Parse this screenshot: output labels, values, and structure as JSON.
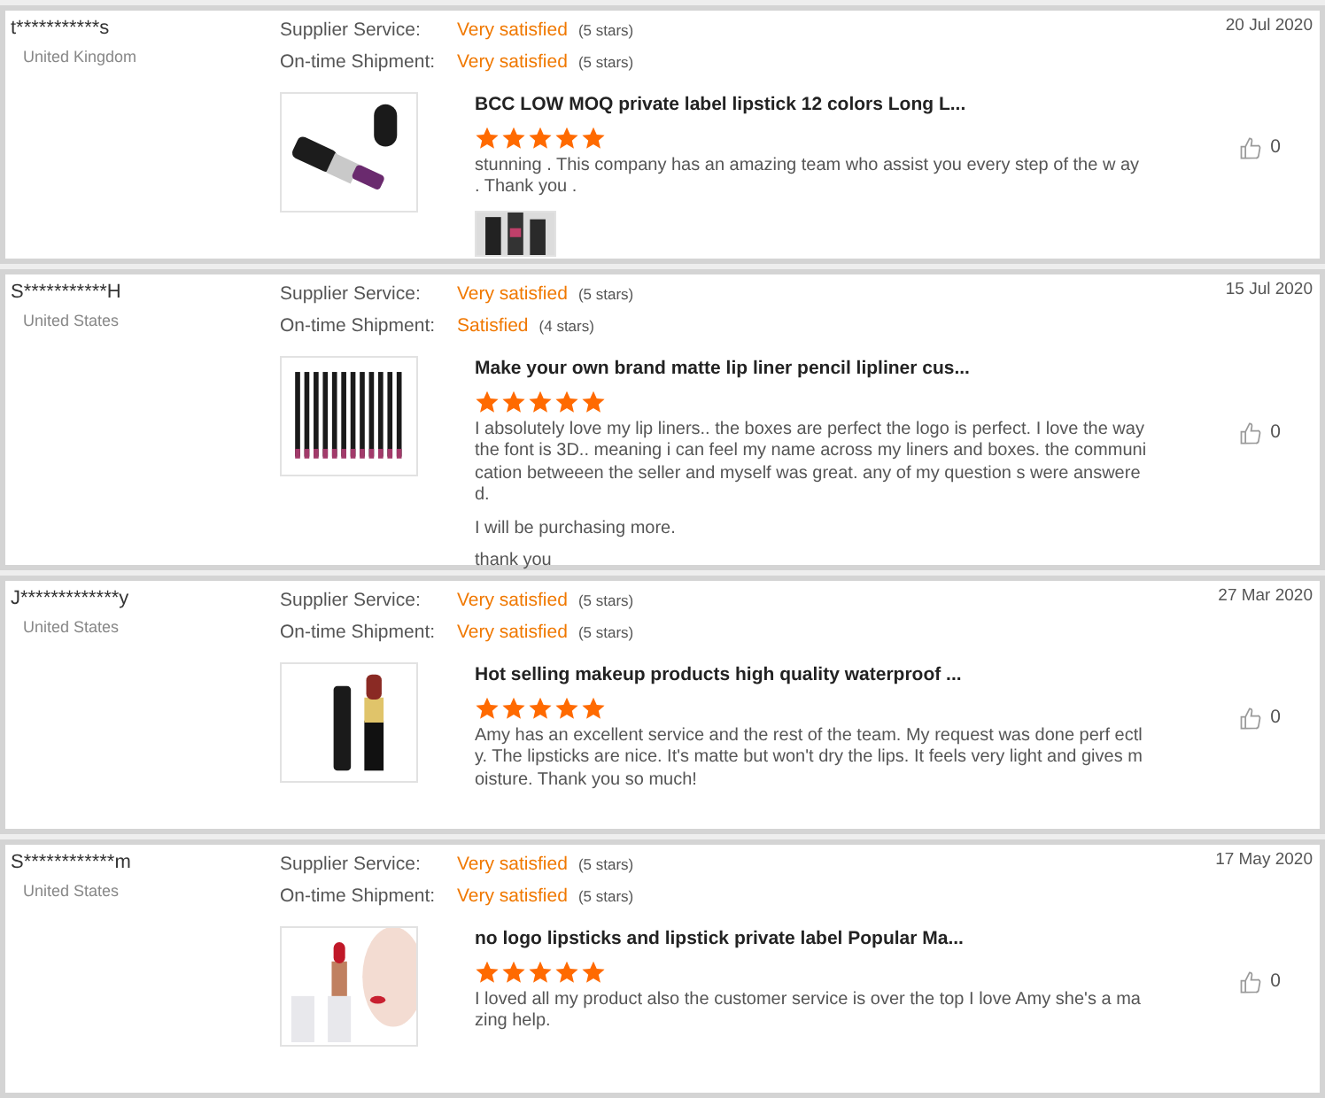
{
  "reviews": [
    {
      "buyer": "t***********s",
      "country": "United Kingdom",
      "date": "20 Jul 2020",
      "ratings": [
        {
          "label": "Supplier Service:",
          "verdict": "Very satisfied",
          "count": "(5 stars)"
        },
        {
          "label": "On-time Shipment:",
          "verdict": "Very satisfied",
          "count": "(5 stars)"
        }
      ],
      "product_image": {
        "kind": "picture"
      },
      "product": "BCC LOW MOQ private label lipstick 12 colors Long L...",
      "stars": 5,
      "paragraphs": [
        "stunning . This company has an amazing team who assist you every step of the w ay . Thank you ."
      ],
      "likes": "0",
      "attachment": {
        "kind": "picture"
      }
    },
    {
      "buyer": "S***********H",
      "country": "United States",
      "date": "15 Jul 2020",
      "ratings": [
        {
          "label": "Supplier Service:",
          "verdict": "Very satisfied",
          "count": "(5 stars)"
        },
        {
          "label": "On-time Shipment:",
          "verdict": "Satisfied",
          "count": "(4 stars)"
        }
      ],
      "product_image": {
        "kind": "picture"
      },
      "product": "Make your own brand matte lip liner pencil lipliner cus...",
      "stars": 5,
      "paragraphs": [
        "I absolutely love my lip liners.. the boxes are perfect the logo is perfect. I  love the way the font is 3D.. meaning i can feel my name across my liners and boxes. the communication betweeen the seller and myself was great. any of my question s were answered.",
        "I will be purchasing more.",
        "thank you"
      ],
      "likes": "0"
    },
    {
      "buyer": "J*************y",
      "country": "United States",
      "date": "27 Mar 2020",
      "ratings": [
        {
          "label": "Supplier Service:",
          "verdict": "Very satisfied",
          "count": "(5 stars)"
        },
        {
          "label": "On-time Shipment:",
          "verdict": "Very satisfied",
          "count": "(5 stars)"
        }
      ],
      "product_image": {
        "kind": "picture"
      },
      "product": "Hot selling makeup products high quality waterproof ...",
      "stars": 5,
      "paragraphs": [
        "Amy has an excellent service and the rest of the team. My request was done perf ectly. The lipsticks are nice. It's matte but won't dry the lips. It feels very light and gives moisture. Thank you so much!"
      ],
      "likes": "0"
    },
    {
      "buyer": "S************m",
      "country": "United States",
      "date": "17 May 2020",
      "ratings": [
        {
          "label": "Supplier Service:",
          "verdict": "Very satisfied",
          "count": "(5 stars)"
        },
        {
          "label": "On-time Shipment:",
          "verdict": "Very satisfied",
          "count": "(5 stars)"
        }
      ],
      "product_image": {
        "kind": "picture"
      },
      "product": "no logo lipsticks and lipstick private label Popular Ma...",
      "stars": 5,
      "paragraphs": [
        "I loved all my product also the customer service is over the top I love Amy she's a mazing help."
      ],
      "likes": "0"
    }
  ]
}
